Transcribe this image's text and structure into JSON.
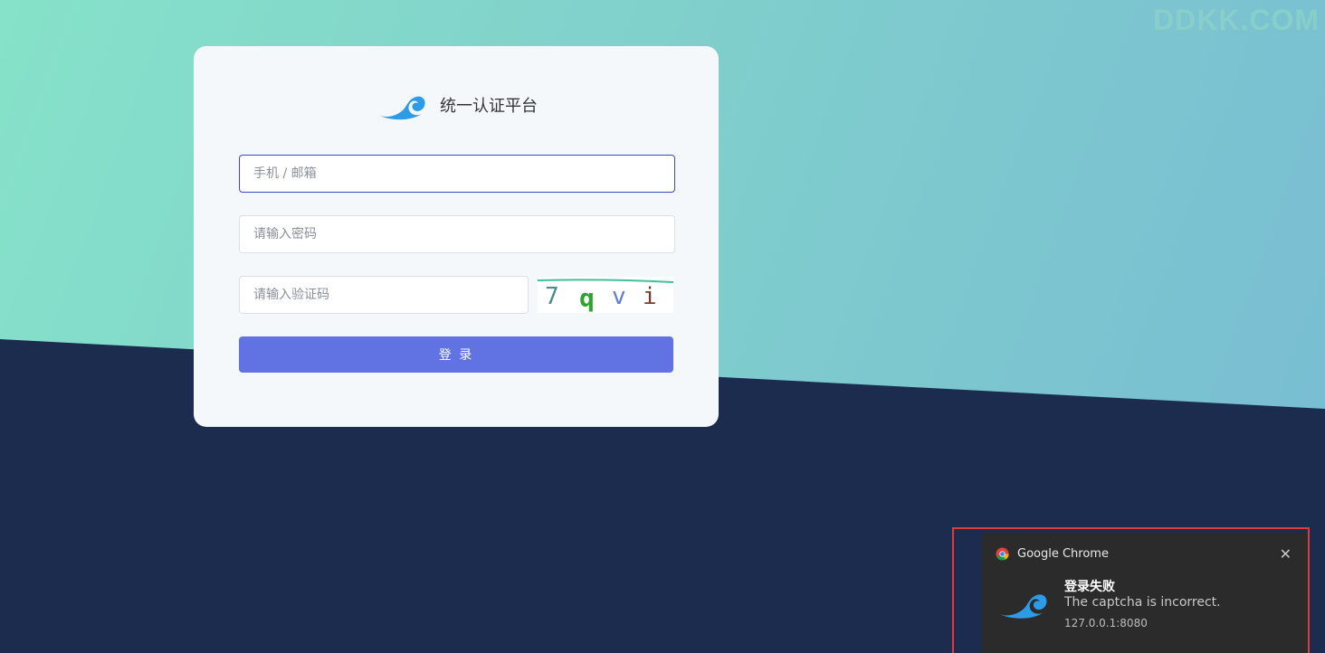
{
  "watermark": "DDKK.COM",
  "login": {
    "title": "统一认证平台",
    "account_placeholder": "手机 / 邮箱",
    "password_placeholder": "请输入密码",
    "captcha_placeholder": "请输入验证码",
    "captcha_chars": [
      "7",
      "q",
      "v",
      "i"
    ],
    "submit_label": "登 录"
  },
  "notification": {
    "app_name": "Google Chrome",
    "title": "登录失败",
    "message": "The captcha is incorrect.",
    "source": "127.0.0.1:8080"
  },
  "colors": {
    "accent": "#6172e3",
    "logo": "#2d9be8",
    "bg_dark": "#1b2c4f",
    "bg_teal": "#86e2c9",
    "highlight_border": "#e03a3a"
  }
}
